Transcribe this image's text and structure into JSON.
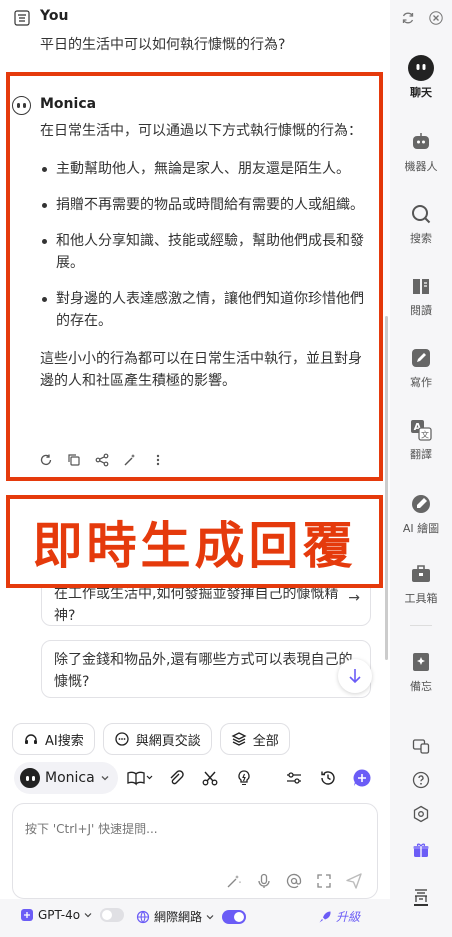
{
  "conversation": {
    "user": {
      "name": "You",
      "message": "平日的生活中可以如何執行慷慨的行為?"
    },
    "assistant": {
      "name": "Monica",
      "intro": "在日常生活中，可以通過以下方式執行慷慨的行為：",
      "bullets": [
        "主動幫助他人，無論是家人、朋友還是陌生人。",
        "捐贈不再需要的物品或時間給有需要的人或組織。",
        "和他人分享知識、技能或經驗，幫助他們成長和發展。",
        "對身邊的人表達感激之情，讓他們知道你珍惜他們的存在。"
      ],
      "conclusion": "這些小小的行為都可以在日常生活中執行，並且對身邊的人和社區產生積極的影響。"
    }
  },
  "overlay": {
    "banner_text": "即時生成回覆",
    "accent": "#e53a0c"
  },
  "suggestions": [
    {
      "text": "在工作或生活中,如何發掘並發揮自己的慷慨精神?"
    },
    {
      "text": "除了金錢和物品外,還有哪些方式可以表現自己的慷慨?"
    }
  ],
  "chips": {
    "ai_search": "AI搜索",
    "chat_with_page": "與網頁交談",
    "all": "全部"
  },
  "toolbar": {
    "bot_name": "Monica"
  },
  "composer": {
    "placeholder": "按下 'Ctrl+J' 快速提問..."
  },
  "bottom_bar": {
    "model": "GPT-4o",
    "web_access": "網際網路",
    "web_access_on": true,
    "upgrade": "升級",
    "brand_color": "#6b5cf6"
  },
  "sidebar": {
    "items": [
      {
        "label": "聊天",
        "icon": "chat-bot-icon",
        "active": true
      },
      {
        "label": "機器人",
        "icon": "robot-icon"
      },
      {
        "label": "搜索",
        "icon": "search-icon"
      },
      {
        "label": "閱讀",
        "icon": "book-icon"
      },
      {
        "label": "寫作",
        "icon": "pencil-icon"
      },
      {
        "label": "翻譯",
        "icon": "translate-icon"
      },
      {
        "label": "AI 繪圖",
        "icon": "palette-icon"
      },
      {
        "label": "工具箱",
        "icon": "toolbox-icon"
      },
      {
        "label": "備忘",
        "icon": "memo-icon"
      }
    ]
  }
}
